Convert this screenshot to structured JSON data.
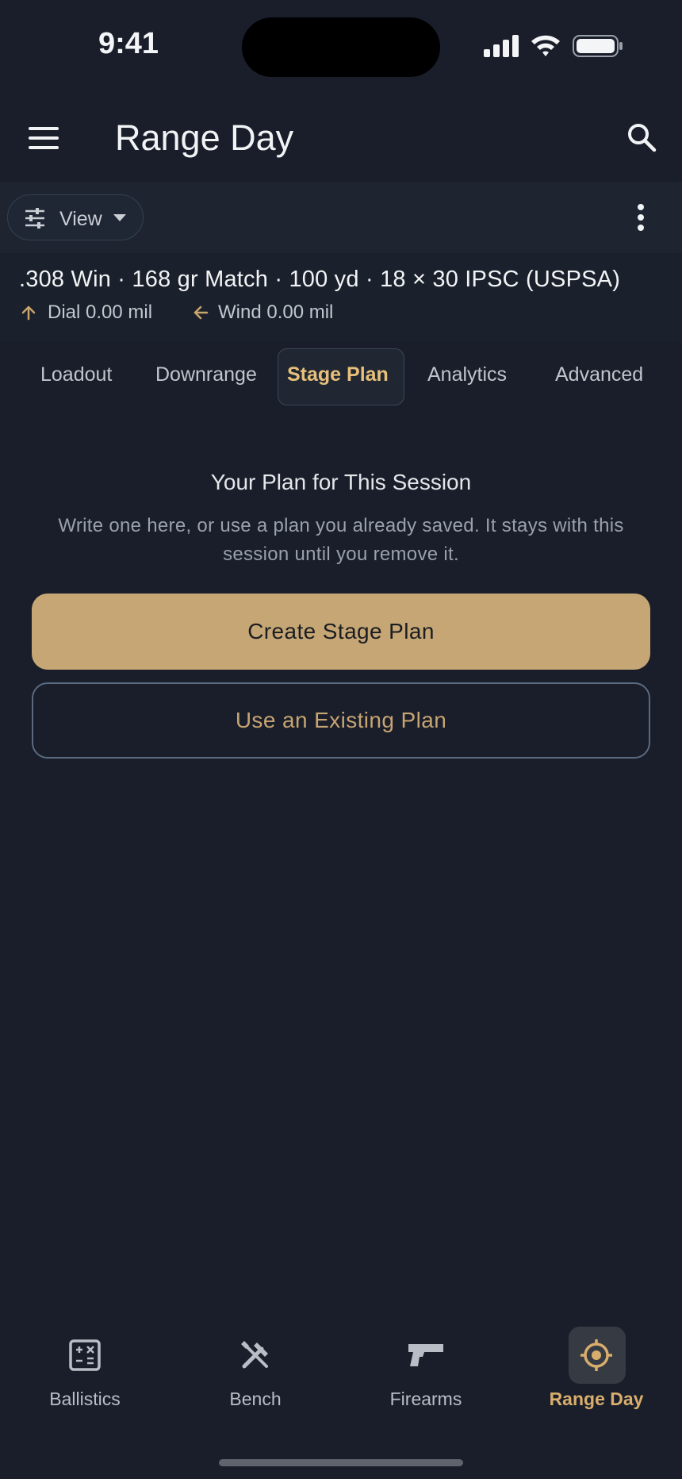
{
  "status": {
    "time": "9:41"
  },
  "app": {
    "title": "Range Day"
  },
  "toolbar": {
    "view_label": "View"
  },
  "session": {
    "summary": ".308 Win · 168 gr Match · 100 yd · 18 × 30 IPSC (USPSA)",
    "dial": "Dial 0.00 mil",
    "wind": "Wind 0.00 mil"
  },
  "tabs": [
    {
      "label": "Loadout"
    },
    {
      "label": "Downrange"
    },
    {
      "label": "Stage Plan",
      "active": true
    },
    {
      "label": "Analytics"
    },
    {
      "label": "Advanced"
    }
  ],
  "plan": {
    "heading": "Your Plan for This Session",
    "description": "Write one here, or use a plan you already saved. It stays with this session until you remove it.",
    "create_button": "Create Stage Plan",
    "existing_button": "Use an Existing Plan"
  },
  "bottom_nav": [
    {
      "label": "Ballistics",
      "icon": "calculator-icon"
    },
    {
      "label": "Bench",
      "icon": "tools-icon"
    },
    {
      "label": "Firearms",
      "icon": "pistol-icon"
    },
    {
      "label": "Range Day",
      "icon": "target-icon",
      "active": true
    }
  ],
  "colors": {
    "background": "#191e2a",
    "accent": "#c5a674",
    "accent_text": "#d9ad6c"
  }
}
